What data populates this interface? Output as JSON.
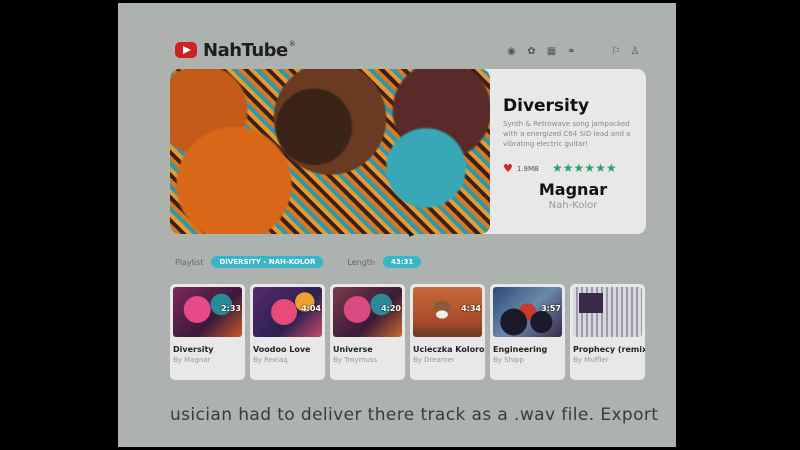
{
  "app": {
    "brand": "NahTube",
    "brand_mark": "®",
    "header_icons": [
      "disc-icon",
      "palette-icon",
      "grid-icon",
      "link-icon"
    ],
    "user_icons": [
      "chat-icon",
      "user-icon"
    ]
  },
  "hero": {
    "title": "Diversity",
    "description": "Synth & Retrowave song jampacked with a energized C64 SID lead and a vibrating electric guitar!",
    "likes": "1.9MB",
    "rating_stars": 6,
    "artist": "Magnar",
    "label": "Nah-Kolor"
  },
  "info": {
    "playlist_label": "Playlist",
    "playlist_value": "DIVERSITY - NAH-KOLOR",
    "length_label": "Length",
    "length_value": "43:31"
  },
  "tracks": [
    {
      "title": "Diversity",
      "by": "By Magnar",
      "duration": "2:33"
    },
    {
      "title": "Voodoo Love",
      "by": "By Rexiaq",
      "duration": "4:04"
    },
    {
      "title": "Universe",
      "by": "By Troymuss",
      "duration": "4:20"
    },
    {
      "title": "Ucieczka Kolorow",
      "by": "By Dreamer",
      "duration": "4:34"
    },
    {
      "title": "Engineering",
      "by": "By Shipp",
      "duration": "3:57"
    },
    {
      "title": "Prophecy (remix)",
      "by": "By Muffler",
      "duration": ""
    }
  ],
  "ticker": "usician had to deliver there track as a .wav file. Export",
  "colors": {
    "accent": "#38b6c8",
    "heart": "#dd2222",
    "stars": "#2aa36a",
    "brand_red": "#cc2222"
  }
}
